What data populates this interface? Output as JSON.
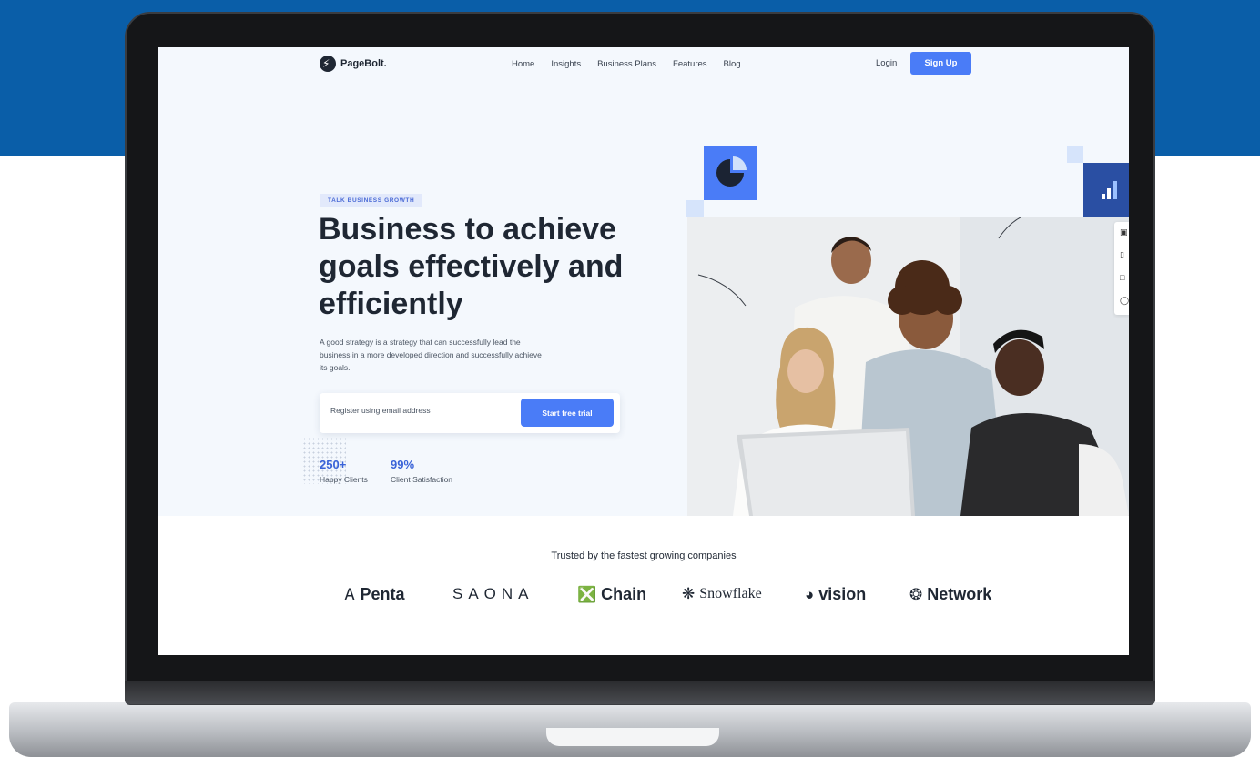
{
  "nav": {
    "logo_text": "PageBolt.",
    "menu": [
      "Home",
      "Insights",
      "Business Plans",
      "Features",
      "Blog"
    ],
    "login_label": "Login",
    "signup_label": "Sign Up"
  },
  "hero": {
    "eyebrow": "TALK BUSINESS GROWTH",
    "headline": "Business to achieve goals effectively and efficiently",
    "subtext": "A good strategy is a strategy that can successfully lead the business in a more developed direction and successfully achieve its goals.",
    "email_placeholder": "Register using email address",
    "cta_label": "Start free trial",
    "stats": [
      {
        "value": "250+",
        "label": "Happy Clients"
      },
      {
        "value": "99%",
        "label": "Client Satisfaction"
      }
    ]
  },
  "trusted": {
    "title": "Trusted by the fastest growing companies",
    "brands": [
      {
        "name": "Penta",
        "icon": "penta-logo-icon"
      },
      {
        "name": "SAONA",
        "icon": "saona-sun-icon"
      },
      {
        "name": "Chain",
        "icon": "chain-logo-icon"
      },
      {
        "name": "Snowflake",
        "icon": "snowflake-logo-icon"
      },
      {
        "name": "vision",
        "icon": "vision-logo-icon"
      },
      {
        "name": "Network",
        "icon": "network-logo-icon"
      }
    ]
  },
  "colors": {
    "accent": "#4a7cf7",
    "navy": "#2a4fa3",
    "background_band": "#0a5ea8",
    "text_dark": "#1f2733"
  }
}
